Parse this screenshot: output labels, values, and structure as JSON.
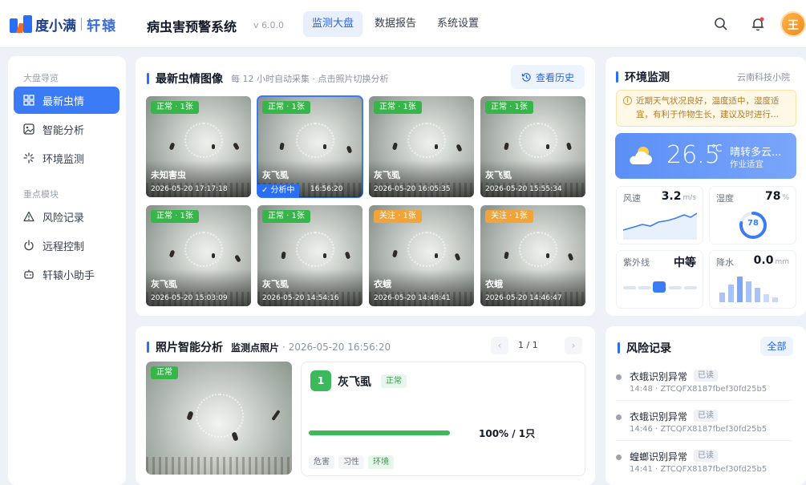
{
  "brand": {
    "name1": "度小满",
    "name2": "轩辕",
    "title": "病虫害预警系统",
    "version": "v 6.0.0"
  },
  "nav": [
    {
      "label": "监测大盘",
      "active": true
    },
    {
      "label": "数据报告"
    },
    {
      "label": "系统设置"
    }
  ],
  "header": {
    "avatar_text": "王",
    "icons": [
      "search-icon",
      "bell-icon"
    ]
  },
  "sidebar": {
    "group1": "大盘导览",
    "items1": [
      {
        "label": "最新虫情",
        "icon": "grid-icon",
        "active": true
      },
      {
        "label": "智能分析",
        "icon": "image-icon"
      },
      {
        "label": "环境监测",
        "icon": "loading-icon"
      }
    ],
    "group2": "重点模块",
    "items2": [
      {
        "label": "风险记录",
        "icon": "warning-icon"
      },
      {
        "label": "远程控制",
        "icon": "power-icon"
      },
      {
        "label": "轩辕小助手",
        "icon": "robot-icon"
      }
    ]
  },
  "latest": {
    "title": "最新虫情图像",
    "subtitle": "每 12 小时自动采集 · 点击照片切换分析",
    "history_btn": "查看历史",
    "thumbs": [
      {
        "tag": "正常 · 1张",
        "tone": "ok",
        "name": "未知害虫",
        "time": "2026-05-20 17:17:18"
      },
      {
        "tag": "正常 · 1张",
        "tone": "ok",
        "name": "灰飞虱",
        "time": "16:56:20",
        "analyzing": "✓ 分析中",
        "selected": true
      },
      {
        "tag": "正常 · 1张",
        "tone": "ok",
        "name": "灰飞虱",
        "time": "2026-05-20 16:05:35"
      },
      {
        "tag": "正常 · 1张",
        "tone": "ok",
        "name": "灰飞虱",
        "time": "2026-05-20 15:55:34"
      },
      {
        "tag": "正常 · 1张",
        "tone": "ok",
        "name": "灰飞虱",
        "time": "2026-05-20 15:03:09"
      },
      {
        "tag": "正常 · 1张",
        "tone": "ok",
        "name": "灰飞虱",
        "time": "2026-05-20 14:54:16"
      },
      {
        "tag": "关注 · 1张",
        "tone": "warn",
        "name": "衣蛾",
        "time": "2026-05-20 14:48:41"
      },
      {
        "tag": "关注 · 1张",
        "tone": "warn",
        "name": "衣蛾",
        "time": "2026-05-20 14:46:47"
      }
    ]
  },
  "env": {
    "title": "环境监测",
    "location": "云南科技小院",
    "note": "近期天气状况良好，温度适中，湿度适宜，有利于作物生长，建议及时进行...",
    "temp": "26.5",
    "temp_unit": "℃",
    "weather": "晴转多云...",
    "work": "作业适宜",
    "wind": {
      "label": "风速",
      "value": "3.2",
      "unit": "m/s"
    },
    "humidity": {
      "label": "湿度",
      "value": "78",
      "unit": "%",
      "gauge": "78"
    },
    "uv": {
      "label": "紫外线",
      "value": "中等"
    },
    "rain": {
      "label": "降水",
      "value": "0.0",
      "unit": "mm"
    }
  },
  "analysis": {
    "title": "照片智能分析",
    "point": "监测点照片",
    "time": "· 2026-05-20 16:56:20",
    "page": "1 / 1",
    "photo_tag": "正常",
    "rank": "1",
    "pest": "灰飞虱",
    "status": "正常",
    "percent": "100% / 1只",
    "progress": 1.0,
    "chips": [
      "危害",
      "习性",
      "环境"
    ]
  },
  "risk": {
    "title": "风险记录",
    "all_btn": "全部",
    "items": [
      {
        "title": "衣蛾识别异常",
        "badge": "已读",
        "meta": "14:48 · ZTCQFX8187fbef30fd25b5"
      },
      {
        "title": "衣蛾识别异常",
        "badge": "已读",
        "meta": "14:46 · ZTCQFX8187fbef30fd25b5"
      },
      {
        "title": "蝗螂识别异常",
        "badge": "已读",
        "meta": "14:41 · ZTCQFX8187fbef30fd25b5"
      }
    ]
  },
  "colors": {
    "accent": "#2b6ef6",
    "ok": "#37b54a",
    "warn": "#f0a43a"
  }
}
